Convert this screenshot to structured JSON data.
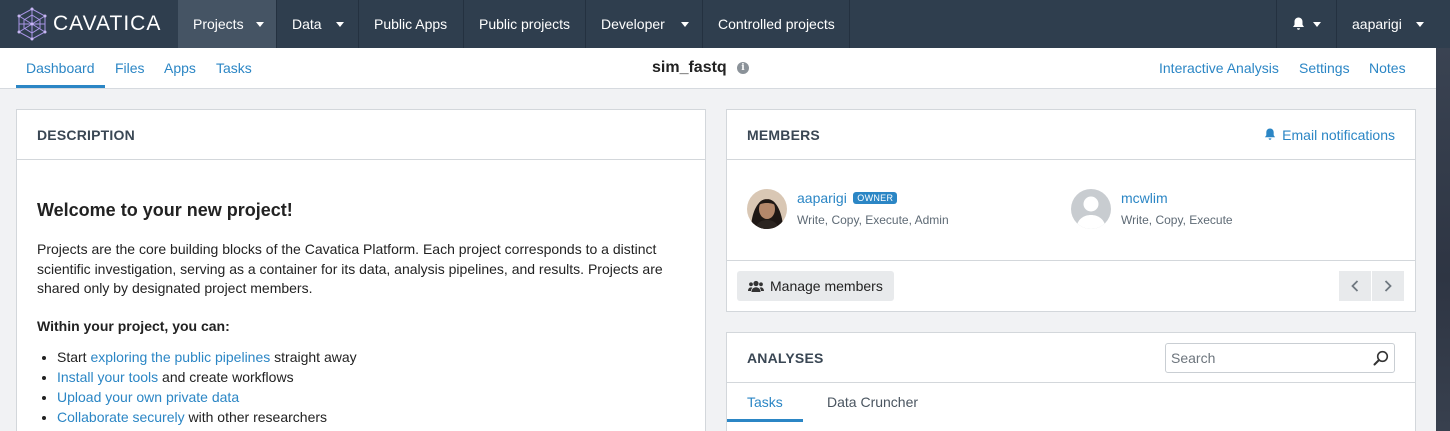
{
  "brand": {
    "name": "CAVATICA",
    "logo_icon": "cavatica-logo-icon"
  },
  "topnav": {
    "items": [
      {
        "label": "Projects",
        "dropdown": true,
        "active": true
      },
      {
        "label": "Data",
        "dropdown": true
      },
      {
        "label": "Public Apps",
        "dropdown": false
      },
      {
        "label": "Public projects",
        "dropdown": false
      },
      {
        "label": "Developer",
        "dropdown": true
      },
      {
        "label": "Controlled projects",
        "dropdown": false
      }
    ],
    "notifications_icon": "bell-icon",
    "user": "aaparigi"
  },
  "subnav": {
    "tabs": [
      "Dashboard",
      "Files",
      "Apps",
      "Tasks"
    ],
    "active_tab": "Dashboard",
    "project_title": "sim_fastq",
    "right_links": [
      "Interactive Analysis",
      "Settings",
      "Notes"
    ]
  },
  "description": {
    "title": "DESCRIPTION",
    "welcome": "Welcome to your new project!",
    "paragraph": "Projects are the core building blocks of the Cavatica Platform. Each project corresponds to a distinct scientific investigation, serving as a container for its data, analysis pipelines, and results. Projects are shared only by designated project members.",
    "within_heading": "Within your project, you can:",
    "bullets": [
      {
        "pre": "Start ",
        "link": "exploring the public pipelines",
        "post": " straight away"
      },
      {
        "pre": "",
        "link": "Install your tools",
        "post": " and create workflows"
      },
      {
        "pre": "",
        "link": "Upload your own private data",
        "post": ""
      },
      {
        "pre": "",
        "link": "Collaborate securely",
        "post": " with other researchers"
      }
    ]
  },
  "members": {
    "title": "MEMBERS",
    "email_notifications": "Email notifications",
    "list": [
      {
        "name": "aaparigi",
        "badge": "OWNER",
        "permissions": "Write, Copy, Execute, Admin"
      },
      {
        "name": "mcwlim",
        "badge": "",
        "permissions": "Write, Copy, Execute"
      }
    ],
    "manage_label": "Manage members"
  },
  "analyses": {
    "title": "ANALYSES",
    "search_placeholder": "Search",
    "tabs": [
      "Tasks",
      "Data Cruncher"
    ],
    "active_tab": "Tasks"
  },
  "colors": {
    "nav_bg": "#2f3e4e",
    "nav_active": "#455464",
    "accent": "#2b86c5"
  }
}
